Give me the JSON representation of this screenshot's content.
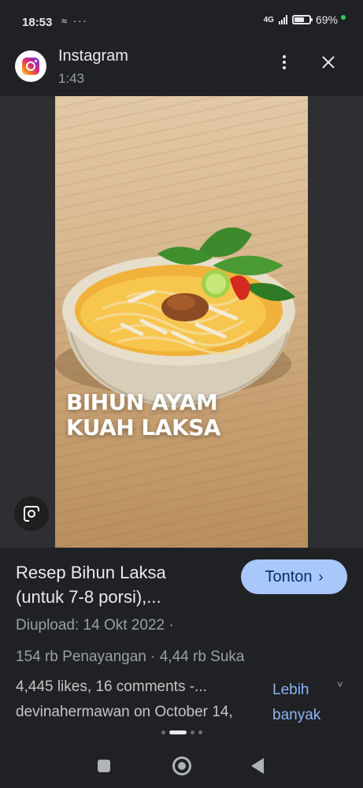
{
  "status_bar": {
    "time": "18:53",
    "notif_icons": "≈ ···",
    "network": "4G",
    "battery": "69%",
    "battery_level": 0.69
  },
  "header": {
    "app_name": "Instagram",
    "duration": "1:43",
    "more_icon": "more-vert-icon",
    "close_icon": "close-icon"
  },
  "video": {
    "caption_line1": "BIHUN AYAM",
    "caption_line2": "KUAH LAKSA"
  },
  "result": {
    "title_line1": "Resep Bihun Laksa",
    "title_line2": "(untuk 7-8 porsi),...",
    "watch_label": "Tonton",
    "watch_chevron": "›",
    "uploaded": "Diupload: 14 Okt 2022 ·",
    "stats": "154 rb Penayangan · 4,44 rb Suka",
    "desc_line1": "4,445 likes, 16 comments -...",
    "desc_line2": "devinahermawan on October 14,",
    "more_label_line1": "Lebih",
    "more_label_line2": "banyak",
    "expand_glyph": "˅"
  },
  "colors": {
    "background": "#202124",
    "button_bg": "#a8c7fa",
    "link": "#8ab4f8"
  }
}
